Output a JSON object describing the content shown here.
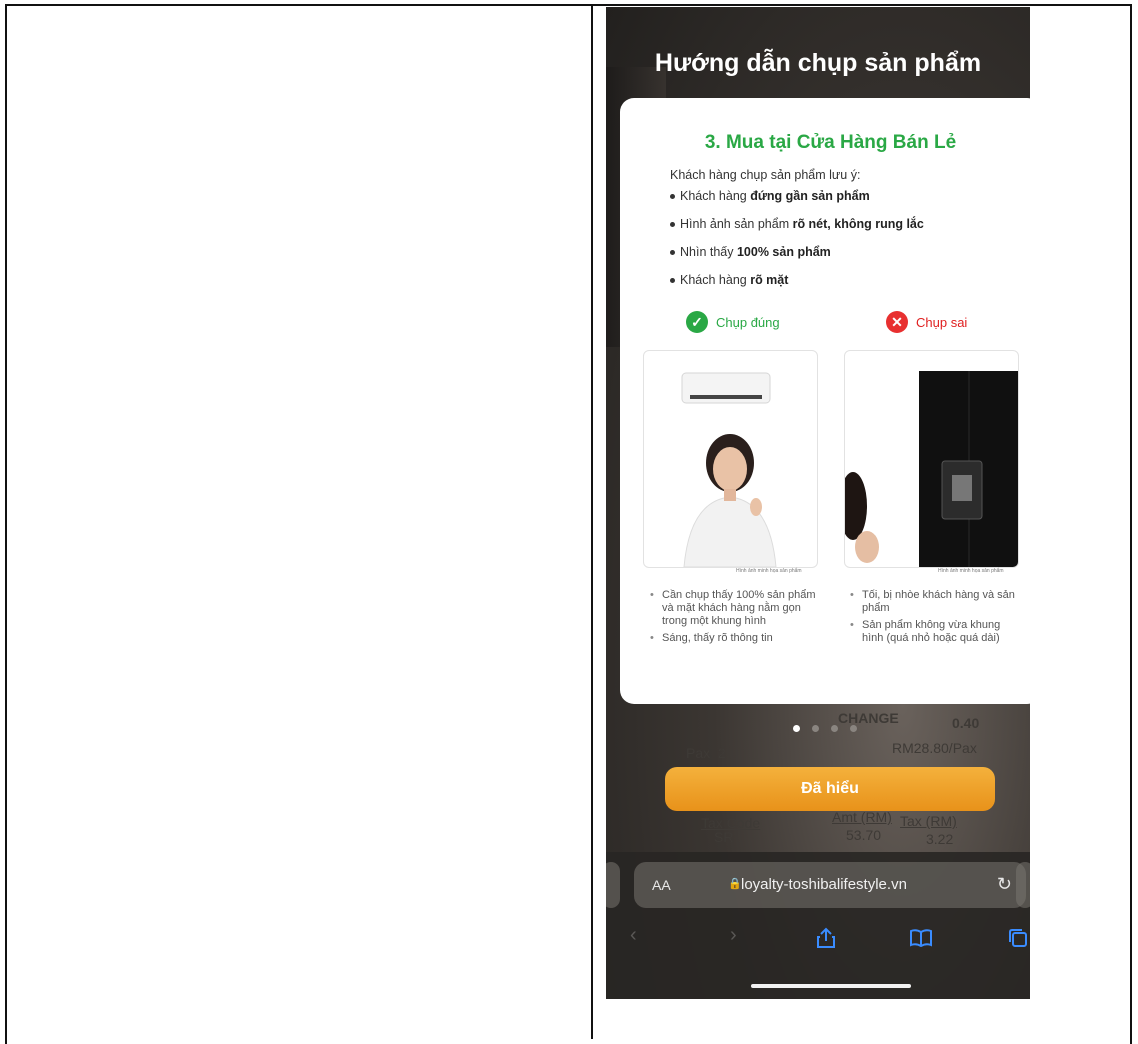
{
  "page_title": "Hướng dẫn chụp sản phẩm",
  "card": {
    "heading": "3. Mua tại Cửa Hàng Bán Lẻ",
    "intro": "Khách hàng chụp sản phẩm lưu ý:",
    "tips": [
      {
        "pre": "Khách hàng ",
        "bold": "đứng gần sản phẩm",
        "post": ""
      },
      {
        "pre": "Hình ảnh sản phẩm ",
        "bold": "rõ nét, không rung lắc",
        "post": ""
      },
      {
        "pre": "Nhìn thấy ",
        "bold": "100% sản phẩm",
        "post": ""
      },
      {
        "pre": "Khách hàng ",
        "bold": "rõ mặt",
        "post": ""
      }
    ],
    "correct_label": "Chụp đúng",
    "wrong_label": "Chụp sai",
    "caption": "Hình ảnh minh họa sản phẩm",
    "correct_notes": [
      "Cần chụp thấy 100% sản phẩm và mặt khách hàng nằm gọn trong một khung hình",
      "Sáng, thấy rõ thông tin"
    ],
    "wrong_notes": [
      "Tối, bị nhòe khách hàng và sản phẩm",
      "Sản phẩm không vừa khung hình (quá nhỏ hoặc quá dài)"
    ]
  },
  "background_receipt": {
    "change_label": "CHANGE",
    "change_value": "0.40",
    "pax": "Pax  2",
    "pax_price": "RM28.80/Pax",
    "tax_code": "Tax Code",
    "tax_code_value": "SR",
    "amt_label": "Amt (RM)",
    "amt_value": "53.70",
    "tax_label": "Tax (RM)",
    "tax_value": "3.22"
  },
  "pager": {
    "total": 4,
    "active_index": 0
  },
  "cta_label": "Đã hiểu",
  "safari": {
    "text_size_label": "AA",
    "url": "loyalty-toshibalifestyle.vn"
  },
  "colors": {
    "green": "#2aa845",
    "red": "#e83030",
    "cta": "#f0a530"
  },
  "icons": [
    "check-icon",
    "x-icon",
    "lock-icon",
    "reload-icon",
    "back-icon",
    "forward-icon",
    "share-icon",
    "bookmarks-icon",
    "tabs-icon"
  ]
}
